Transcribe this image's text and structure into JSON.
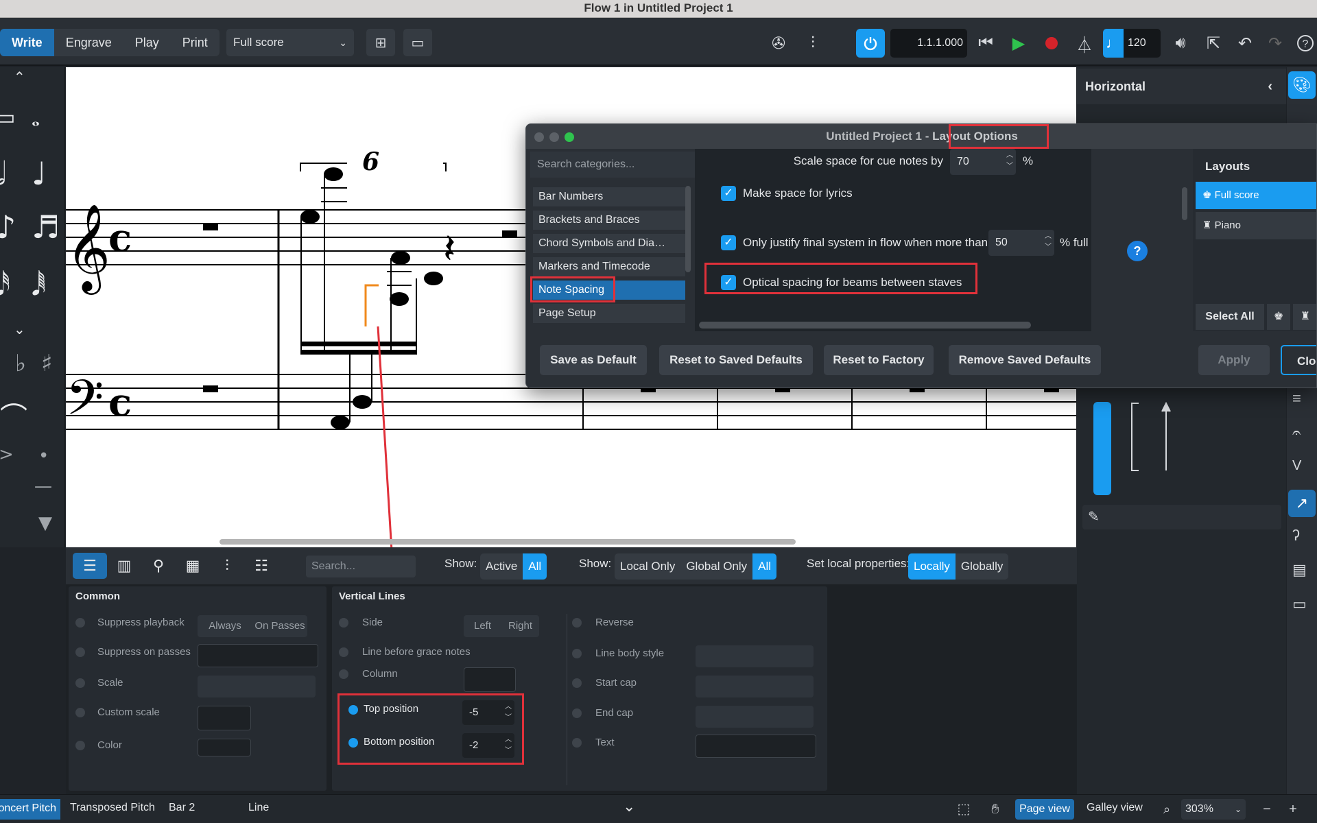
{
  "window": {
    "title": "Flow 1 in Untitled Project 1"
  },
  "toolbar": {
    "modes": [
      "Write",
      "Engrave",
      "Play",
      "Print"
    ],
    "layout_select": "Full score",
    "position": "1.1.1.000",
    "tempo": "120"
  },
  "right_panel": {
    "title": "Horizontal"
  },
  "dialog": {
    "title_prefix": "Untitled Project 1 - ",
    "title_highlight": "Layout Options",
    "search_placeholder": "Search categories...",
    "categories": [
      "Bar Numbers",
      "Brackets and Braces",
      "Chord Symbols and Dia…",
      "Markers and Timecode",
      "Note Spacing",
      "Page Setup"
    ],
    "selected_category": "Note Spacing",
    "options": {
      "cue_label": "Scale space for cue notes by",
      "cue_value": "70",
      "cue_unit": "%",
      "lyrics_label": "Make space for lyrics",
      "justify_label": "Only justify final system in flow when more than",
      "justify_value": "50",
      "justify_unit": "% full",
      "optical_label": "Optical spacing for beams between staves"
    },
    "layouts_title": "Layouts",
    "layouts": [
      "Full score",
      "Piano"
    ],
    "select_all": "Select All",
    "buttons": {
      "save_default": "Save as Default",
      "reset_saved": "Reset to Saved Defaults",
      "reset_factory": "Reset to Factory",
      "remove_saved": "Remove Saved Defaults",
      "apply": "Apply",
      "close": "Clos"
    }
  },
  "score": {
    "tuplet": "6",
    "time_sig": "c"
  },
  "properties_bar": {
    "search_placeholder": "Search...",
    "show1_label": "Show:",
    "show1_options": [
      "Active",
      "All"
    ],
    "show2_label": "Show:",
    "show2_options": [
      "Local Only",
      "Global Only",
      "All"
    ],
    "local_label": "Set local properties:",
    "local_options": [
      "Locally",
      "Globally"
    ]
  },
  "properties": {
    "common": {
      "title": "Common",
      "items": [
        "Suppress playback",
        "Suppress on passes",
        "Scale",
        "Custom scale",
        "Color"
      ],
      "playback_options": [
        "Always",
        "On Passes"
      ]
    },
    "vertical_lines": {
      "title": "Vertical Lines",
      "left_items": [
        "Side",
        "Line before grace notes",
        "Column",
        "Top position",
        "Bottom position"
      ],
      "side_options": [
        "Left",
        "Right"
      ],
      "top_value": "-5",
      "bottom_value": "-2",
      "right_items": [
        "Reverse",
        "Line body style",
        "Start cap",
        "End cap",
        "Text"
      ]
    }
  },
  "statusbar": {
    "concert": "Concert Pitch",
    "transposed": "Transposed Pitch",
    "bar": "Bar 2",
    "selection": "Line",
    "page_view": "Page view",
    "galley_view": "Galley view",
    "zoom": "303%"
  },
  "colors": {
    "accent": "#1a9cf0",
    "highlight_red": "#e0313a",
    "tab_blue": "#1f6fb0"
  }
}
